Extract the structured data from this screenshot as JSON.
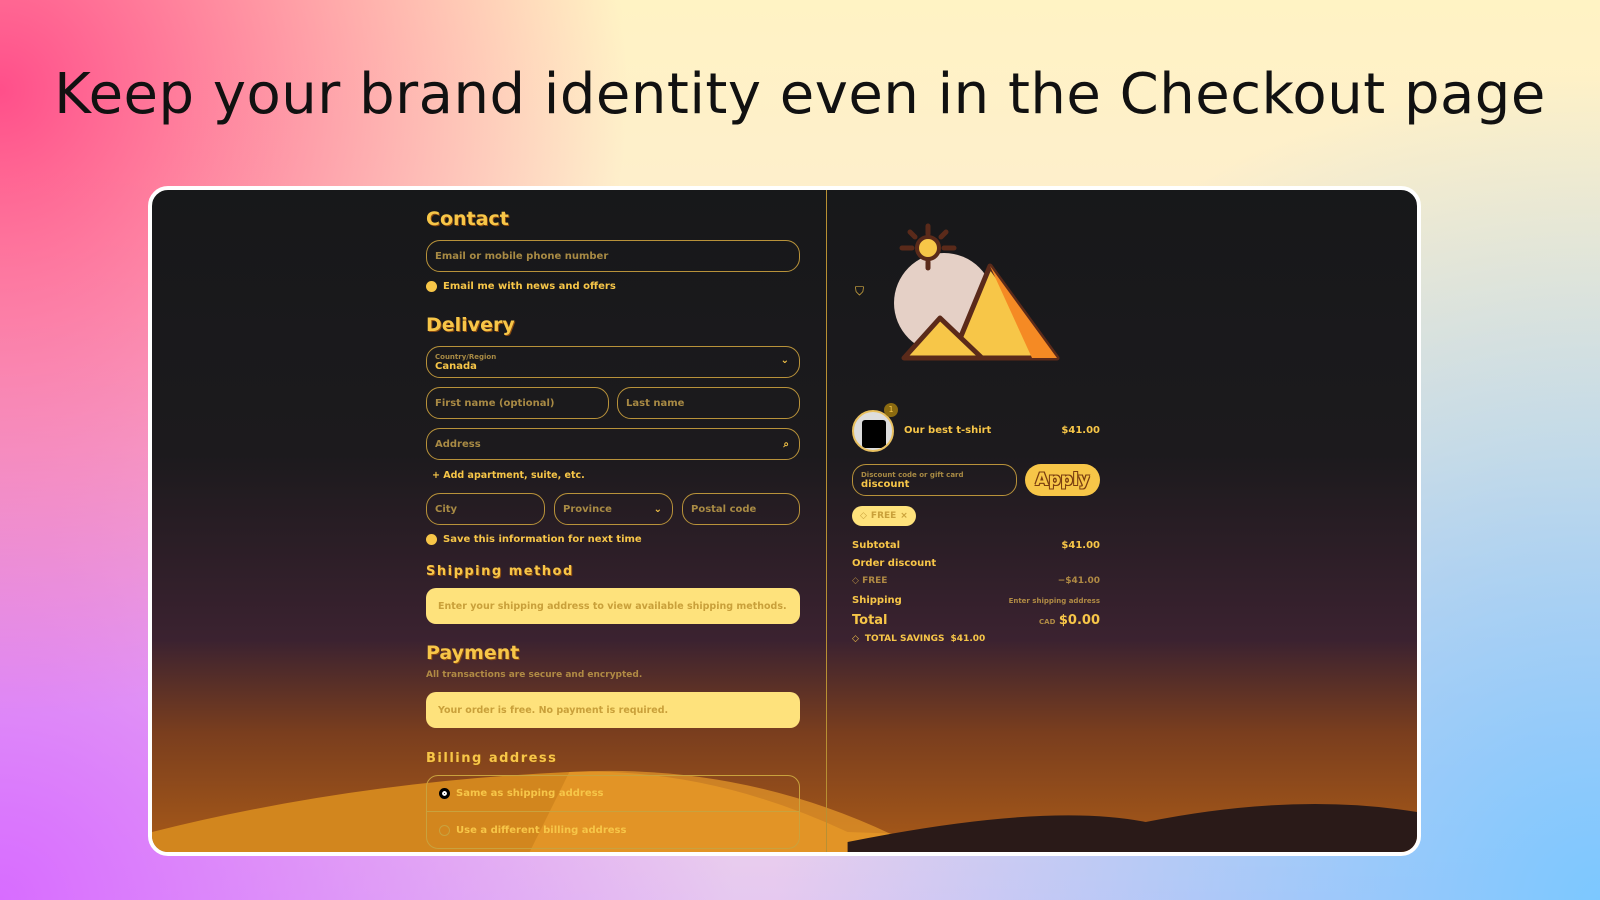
{
  "headline": "Keep your brand identity even in the Checkout page",
  "contact": {
    "title": "Contact",
    "email_placeholder": "Email or mobile phone number",
    "newsletter_label": "Email me with news and offers"
  },
  "delivery": {
    "title": "Delivery",
    "country_label": "Country/Region",
    "country_value": "Canada",
    "first_name_placeholder": "First name (optional)",
    "last_name_placeholder": "Last name",
    "address_placeholder": "Address",
    "add_apartment": "+ Add apartment, suite, etc.",
    "city_placeholder": "City",
    "province_placeholder": "Province",
    "postal_placeholder": "Postal code",
    "save_info_label": "Save this information for next time"
  },
  "shipping": {
    "title": "Shipping method",
    "note": "Enter your shipping address to view available shipping methods."
  },
  "payment": {
    "title": "Payment",
    "subtitle": "All transactions are secure and encrypted.",
    "note": "Your order is free. No payment is required."
  },
  "billing": {
    "title": "Billing address",
    "options": [
      {
        "label": "Same as shipping address",
        "selected": true
      },
      {
        "label": "Use a different billing address",
        "selected": false
      }
    ]
  },
  "summary": {
    "item": {
      "name": "Our best t-shirt",
      "price": "$41.00",
      "quantity": "1"
    },
    "discount_label": "Discount code or gift card",
    "discount_value": "discount",
    "apply_label": "Apply",
    "applied_code": "FREE",
    "subtotal_label": "Subtotal",
    "subtotal_value": "$41.00",
    "order_discount_label": "Order discount",
    "discount_code": "FREE",
    "discount_amount": "−$41.00",
    "shipping_label": "Shipping",
    "shipping_value": "Enter shipping address",
    "total_label": "Total",
    "currency": "CAD",
    "total_value": "$0.00",
    "savings_label": "TOTAL SAVINGS",
    "savings_value": "$41.00"
  },
  "colors": {
    "accent": "#f7c648",
    "note_bg": "#fee27c",
    "border": "#b8923a"
  }
}
